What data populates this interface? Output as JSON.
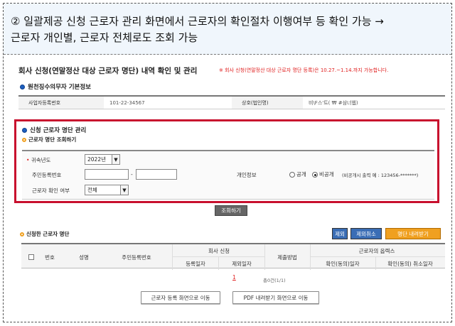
{
  "caption": {
    "line1": "② 일괄제공 신청 근로자 관리 화면에서 근로자의 확인절차 이행여부 등 확인 가능 →",
    "line2": "근로자 개인별, 근로자 전체로도 조회 가능"
  },
  "page": {
    "title": "회사 신청(연말정산 대상 근로자 명단) 내역 확인 및 관리",
    "notice": "※ 회사 신청(연말정산 대상 근로자 명단 등록)은 10.27.~1.14.까지 가능합니다."
  },
  "withholding": {
    "section_title": "원천징수의무자 기본정보",
    "biz_no_label": "사업자등록번호",
    "biz_no_value": "101-22-34567",
    "company_label": "상호(법인명)",
    "company_value": "비\\F스'트( ₩ #삼너웹)"
  },
  "applicant_mgmt": {
    "section_title": "신청 근로자 명단 관리",
    "sub_title": "근로자 명단 조회하기",
    "year_label": "귀속년도",
    "year_value": "2022년",
    "rrn_label": "주민등록번호",
    "rrn_dash": "-",
    "privacy_label": "개인정보",
    "privacy_public": "공개",
    "privacy_private": "비공개",
    "privacy_note": "(비공개시 출력 예 : 123456-*******)",
    "confirm_label": "근로자 확인 여부",
    "confirm_value": "전체",
    "search_btn": "조회하기"
  },
  "applied_list": {
    "section_title": "신청한 근로자 명단",
    "btn_delete": "제외",
    "btn_undo": "제외취소",
    "btn_download": "명단 내려받기",
    "headers": {
      "no": "번호",
      "name": "성명",
      "rrn": "주민등록번호",
      "company_group": "회사 신청",
      "reg_date": "등록일자",
      "excl_date": "제외일자",
      "method": "제출방법",
      "worker_group": "근로자의 옵렉스",
      "agree_date": "확인(동의)일자",
      "cancel_date": "확인(동의) 취소일자"
    },
    "page_num": "1",
    "count": "총0건(1/1)"
  },
  "bottom": {
    "btn_reg": "근로자 등록 화면으로 이동",
    "btn_pdf": "PDF 내려받기 화면으로 이동"
  },
  "colors": {
    "highlight_border": "#c8102e",
    "notice_text": "#e02020",
    "download_btn": "#f0a020",
    "small_btn": "#3a6db5"
  }
}
